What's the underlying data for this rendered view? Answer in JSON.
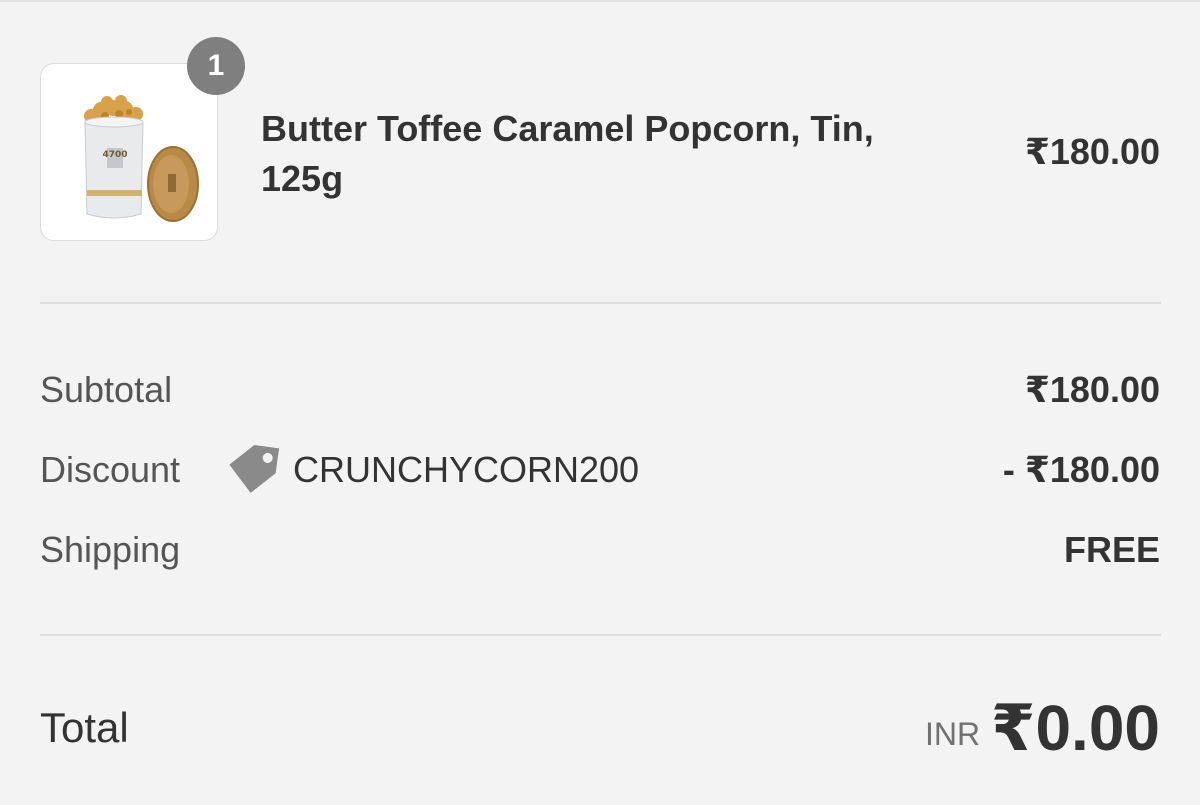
{
  "line_item": {
    "quantity": "1",
    "name": "Butter Toffee Caramel Popcorn, Tin, 125g",
    "price": "₹180.00",
    "image_alt": "popcorn-tin-image"
  },
  "summary": {
    "subtotal_label": "Subtotal",
    "subtotal_value": "₹180.00",
    "discount_label": "Discount",
    "discount_code": "CRUNCHYCORN200",
    "discount_value": "- ₹180.00",
    "shipping_label": "Shipping",
    "shipping_value": "FREE"
  },
  "total": {
    "label": "Total",
    "currency": "INR",
    "amount": "₹0.00"
  },
  "colors": {
    "background": "#f3f3f3",
    "text": "#333333",
    "muted": "#717171",
    "badge": "#7f7f7f",
    "divider": "#dedede"
  }
}
